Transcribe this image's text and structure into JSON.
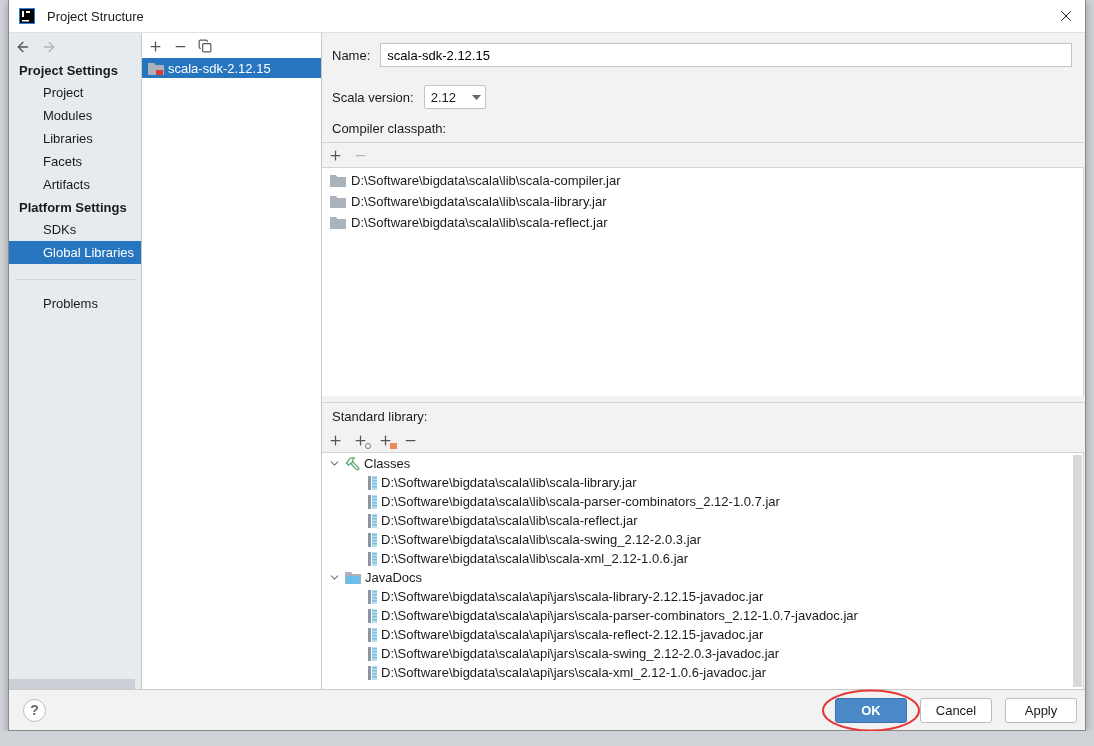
{
  "window": {
    "title": "Project Structure"
  },
  "sidebar": {
    "sections": [
      {
        "heading": "Project Settings",
        "items": [
          {
            "label": "Project",
            "selected": false
          },
          {
            "label": "Modules",
            "selected": false
          },
          {
            "label": "Libraries",
            "selected": false
          },
          {
            "label": "Facets",
            "selected": false
          },
          {
            "label": "Artifacts",
            "selected": false
          }
        ]
      },
      {
        "heading": "Platform Settings",
        "items": [
          {
            "label": "SDKs",
            "selected": false
          },
          {
            "label": "Global Libraries",
            "selected": true
          }
        ]
      }
    ],
    "footer_items": [
      {
        "label": "Problems",
        "selected": false
      }
    ]
  },
  "library_list": {
    "items": [
      {
        "label": "scala-sdk-2.12.15",
        "selected": true
      }
    ]
  },
  "details": {
    "name": {
      "label": "Name:",
      "value": "scala-sdk-2.12.15"
    },
    "scala_version": {
      "label": "Scala version:",
      "value": "2.12"
    },
    "compiler_classpath": {
      "label": "Compiler classpath:",
      "entries": [
        "D:\\Software\\bigdata\\scala\\lib\\scala-compiler.jar",
        "D:\\Software\\bigdata\\scala\\lib\\scala-library.jar",
        "D:\\Software\\bigdata\\scala\\lib\\scala-reflect.jar"
      ]
    },
    "standard_library": {
      "label": "Standard library:",
      "tree": [
        {
          "label": "Classes",
          "kind": "classes",
          "expanded": true,
          "children": [
            "D:\\Software\\bigdata\\scala\\lib\\scala-library.jar",
            "D:\\Software\\bigdata\\scala\\lib\\scala-parser-combinators_2.12-1.0.7.jar",
            "D:\\Software\\bigdata\\scala\\lib\\scala-reflect.jar",
            "D:\\Software\\bigdata\\scala\\lib\\scala-swing_2.12-2.0.3.jar",
            "D:\\Software\\bigdata\\scala\\lib\\scala-xml_2.12-1.0.6.jar"
          ]
        },
        {
          "label": "JavaDocs",
          "kind": "javadocs",
          "expanded": true,
          "children": [
            "D:\\Software\\bigdata\\scala\\api\\jars\\scala-library-2.12.15-javadoc.jar",
            "D:\\Software\\bigdata\\scala\\api\\jars\\scala-parser-combinators_2.12-1.0.7-javadoc.jar",
            "D:\\Software\\bigdata\\scala\\api\\jars\\scala-reflect-2.12.15-javadoc.jar",
            "D:\\Software\\bigdata\\scala\\api\\jars\\scala-swing_2.12-2.0.3-javadoc.jar",
            "D:\\Software\\bigdata\\scala\\api\\jars\\scala-xml_2.12-1.0.6-javadoc.jar"
          ]
        }
      ]
    }
  },
  "help_button": {
    "label": "?"
  },
  "buttons": [
    {
      "label": "OK",
      "kind": "primary",
      "circled": true
    },
    {
      "label": "Cancel",
      "kind": "normal",
      "circled": false
    },
    {
      "label": "Apply",
      "kind": "normal",
      "circled": false
    }
  ]
}
